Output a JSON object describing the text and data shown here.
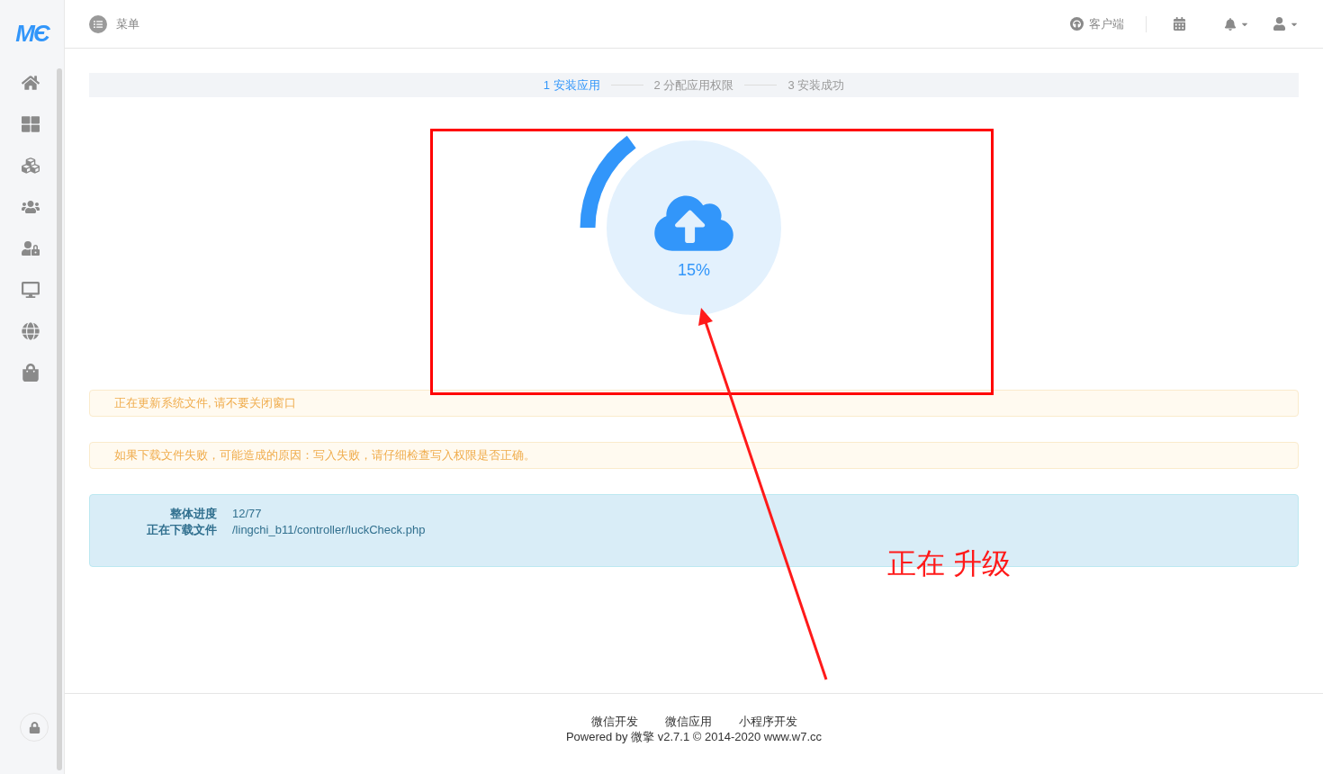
{
  "logo": "MЄ",
  "header": {
    "menu_label": "菜单",
    "client_label": "客户端"
  },
  "sidebar": {
    "items": [
      {
        "kind": "home"
      },
      {
        "kind": "apps"
      },
      {
        "kind": "package"
      },
      {
        "kind": "users"
      },
      {
        "kind": "userlock"
      },
      {
        "kind": "desktop"
      },
      {
        "kind": "globe"
      },
      {
        "kind": "bag"
      }
    ]
  },
  "steps": [
    {
      "label": "1 安装应用",
      "selected": true
    },
    {
      "label": "2 分配应用权限",
      "selected": false
    },
    {
      "label": "3 安装成功",
      "selected": false
    }
  ],
  "progress": {
    "level": 0.15,
    "reading": "15%"
  },
  "alerts": [
    "正在更新系统文件, 请不要关闭窗口",
    "如果下载文件失败，可能造成的原因：写入失败，请仔细检查写入权限是否正确。"
  ],
  "info": [
    {
      "label": "整体进度",
      "value": "12/77"
    },
    {
      "label": "正在下载文件",
      "value": "/lingchi_b11/controller/luckCheck.php"
    }
  ],
  "footer": {
    "links": [
      "微信开发",
      "微信应用",
      "小程序开发"
    ],
    "powered": "Powered by 微擎 v2.7.1 © 2014-2020 www.w7.cc"
  },
  "annotation": {
    "text": "正在 升级"
  }
}
